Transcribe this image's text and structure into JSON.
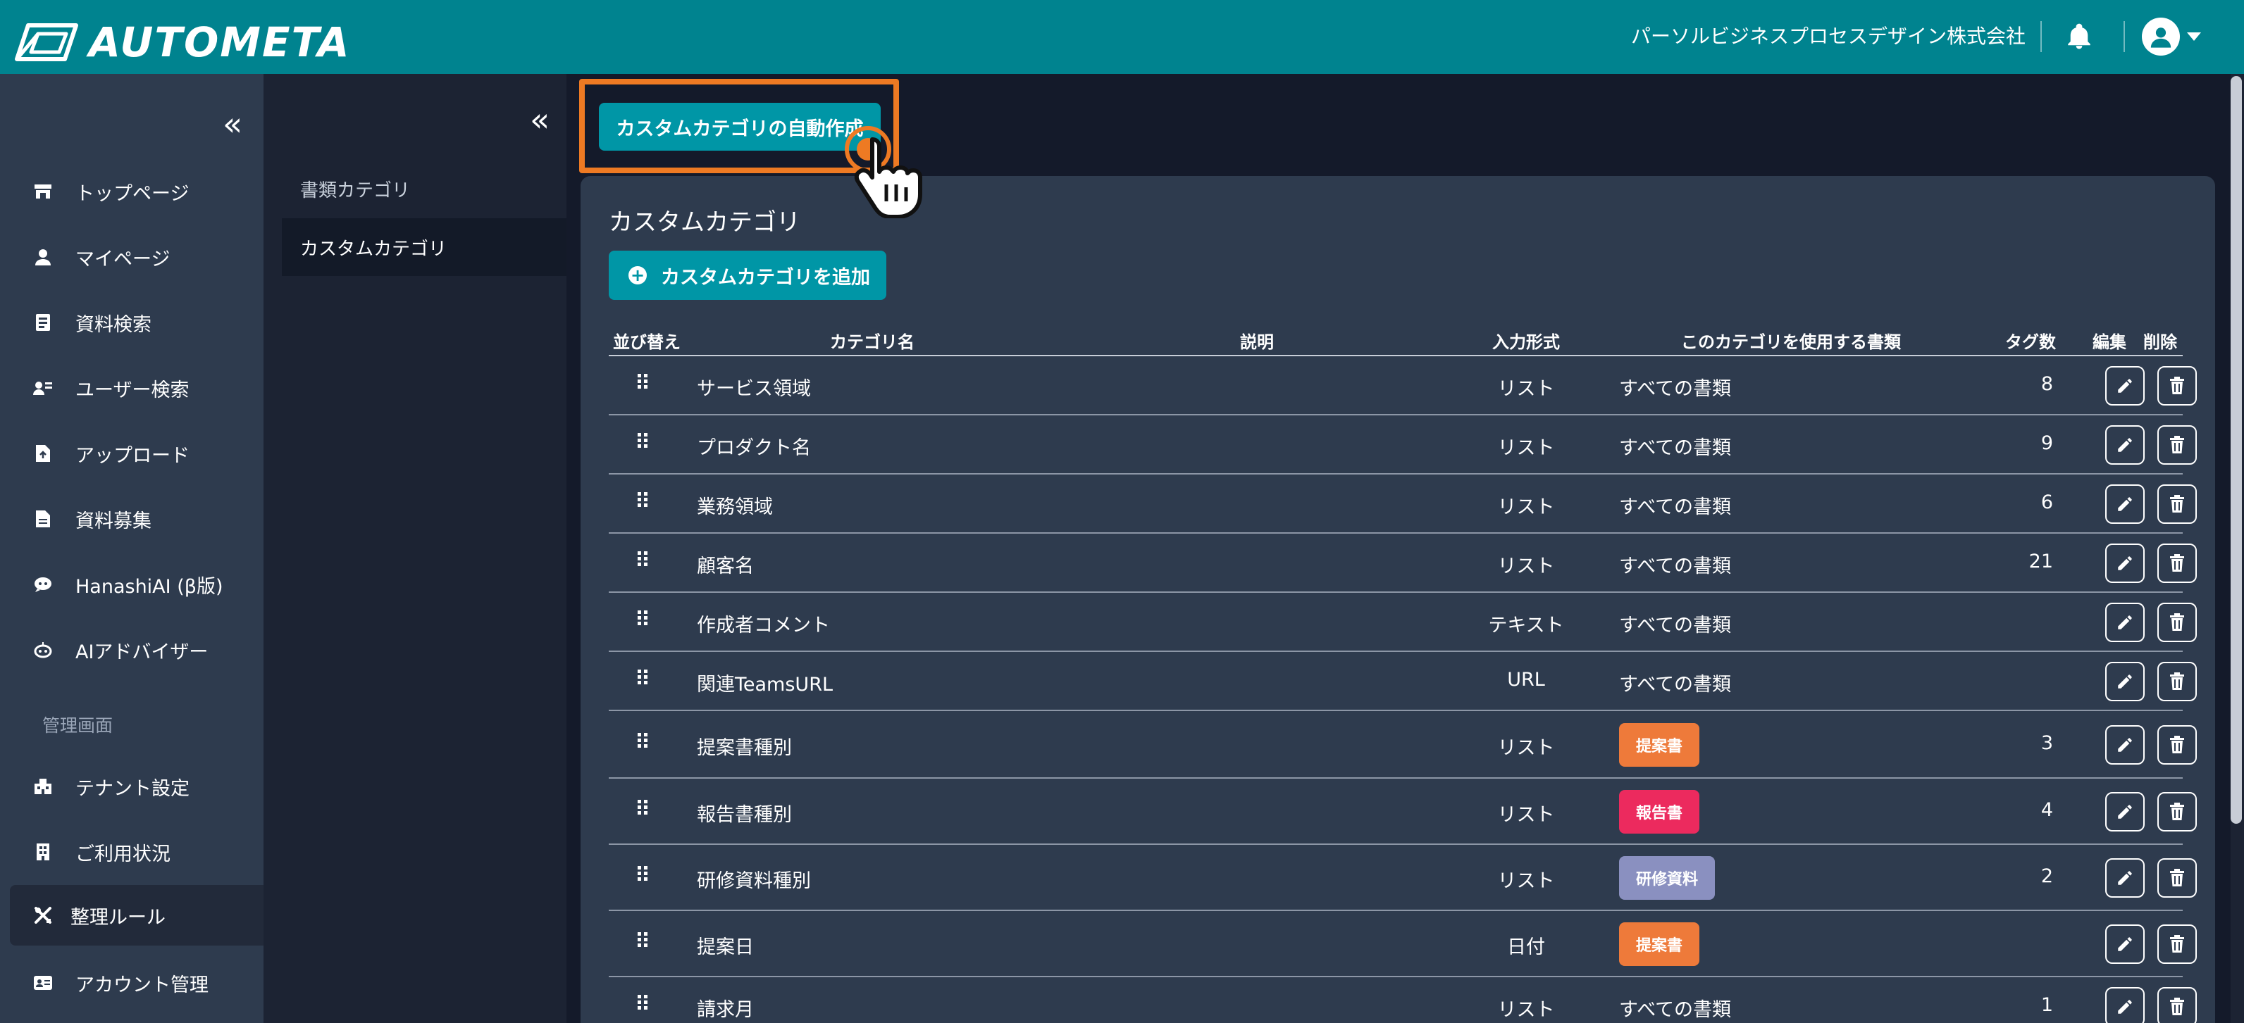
{
  "header": {
    "logo_text": "AUTOMETA",
    "company": "パーソルビジネスプロセスデザイン株式会社",
    "bell_icon": "bell-icon",
    "avatar_icon": "user-icon"
  },
  "sidebar": {
    "collapse_icon": "«",
    "items": [
      {
        "label": "トップページ",
        "icon": "shop-icon"
      },
      {
        "label": "マイページ",
        "icon": "person-icon"
      },
      {
        "label": "資料検索",
        "icon": "document-search-icon"
      },
      {
        "label": "ユーザー検索",
        "icon": "user-search-icon"
      },
      {
        "label": "アップロード",
        "icon": "file-upload-icon"
      },
      {
        "label": "資料募集",
        "icon": "file-icon"
      },
      {
        "label": "HanashiAI (β版)",
        "icon": "chat-bot-icon"
      },
      {
        "label": "AIアドバイザー",
        "icon": "robot-icon"
      }
    ],
    "admin_heading": "管理画面",
    "admin_items": [
      {
        "label": "テナント設定",
        "icon": "tenant-icon"
      },
      {
        "label": "ご利用状況",
        "icon": "building-icon"
      },
      {
        "label": "整理ルール",
        "icon": "tools-icon",
        "active": true
      },
      {
        "label": "アカウント管理",
        "icon": "id-card-icon"
      }
    ]
  },
  "subsidebar": {
    "collapse_icon": "«",
    "items": [
      "書類カテゴリ",
      "カスタムカテゴリ"
    ]
  },
  "main": {
    "auto_create_label": "カスタムカテゴリの自動作成",
    "panel_title": "カスタムカテゴリ",
    "add_label": "カスタムカテゴリを追加",
    "columns": {
      "sort": "並び替え",
      "name": "カテゴリ名",
      "description": "説明",
      "input_type": "入力形式",
      "usage": "このカテゴリを使用する書類",
      "tag_count": "タグ数",
      "edit": "編集",
      "delete": "削除"
    },
    "rows": [
      {
        "name": "サービス領域",
        "type": "リスト",
        "usage": "すべての書類",
        "tags": "8"
      },
      {
        "name": "プロダクト名",
        "type": "リスト",
        "usage": "すべての書類",
        "tags": "9"
      },
      {
        "name": "業務領域",
        "type": "リスト",
        "usage": "すべての書類",
        "tags": "6"
      },
      {
        "name": "顧客名",
        "type": "リスト",
        "usage": "すべての書類",
        "tags": "21"
      },
      {
        "name": "作成者コメント",
        "type": "テキスト",
        "usage": "すべての書類",
        "tags": ""
      },
      {
        "name": "関連TeamsURL",
        "type": "URL",
        "usage": "すべての書類",
        "tags": ""
      },
      {
        "name": "提案書種別",
        "type": "リスト",
        "badge": "提案書",
        "badge_color": "#ee7a3a",
        "tags": "3"
      },
      {
        "name": "報告書種別",
        "type": "リスト",
        "badge": "報告書",
        "badge_color": "#ec2a5e",
        "tags": "4"
      },
      {
        "name": "研修資料種別",
        "type": "リスト",
        "badge": "研修資料",
        "badge_color": "#8a90c0",
        "tags": "2"
      },
      {
        "name": "提案日",
        "type": "日付",
        "badge": "提案書",
        "badge_color": "#ee7a3a",
        "tags": ""
      },
      {
        "name": "請求月",
        "type": "リスト",
        "usage": "すべての書類",
        "tags": "1"
      }
    ]
  }
}
